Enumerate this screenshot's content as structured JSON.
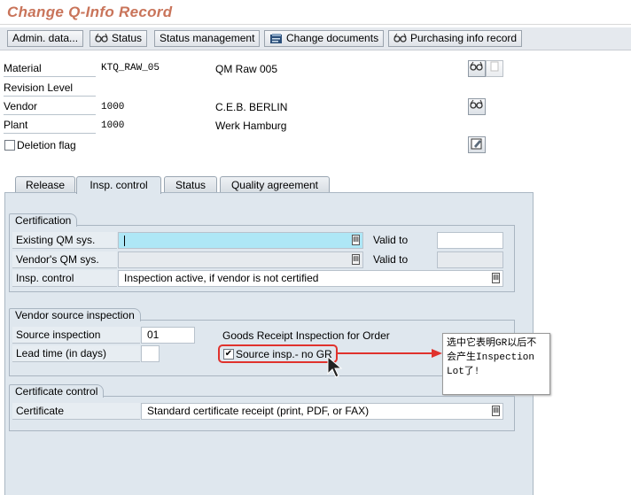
{
  "window": {
    "title": "Change Q-Info Record"
  },
  "toolbar": {
    "admin_data": "Admin. data...",
    "status": "Status",
    "status_management": "Status management",
    "change_documents": "Change documents",
    "purchasing_info_record": "Purchasing info record"
  },
  "header": {
    "material_label": "Material",
    "material_value": "KTQ_RAW_05",
    "material_desc": "QM Raw 005",
    "revision_label": "Revision Level",
    "vendor_label": "Vendor",
    "vendor_value": "1000",
    "vendor_name": "C.E.B. BERLIN",
    "plant_label": "Plant",
    "plant_value": "1000",
    "plant_name": "Werk Hamburg",
    "deletion_flag_label": "Deletion flag",
    "deletion_flag_checked": false
  },
  "tabs": [
    {
      "label": "Release",
      "active": false
    },
    {
      "label": "Insp. control",
      "active": true
    },
    {
      "label": "Status",
      "active": false
    },
    {
      "label": "Quality agreement",
      "active": false
    }
  ],
  "certification": {
    "title": "Certification",
    "existing_label": "Existing QM sys.",
    "existing_value": "",
    "valid_to_label": "Valid to",
    "valid_to_value": "",
    "vendor_qm_label": "Vendor's QM sys.",
    "vendor_qm_value": "",
    "valid_to2_label": "Valid to",
    "valid_to2_value": "",
    "insp_control_label": "Insp. control",
    "insp_control_value": "Inspection active, if vendor is not certified"
  },
  "vendor_source": {
    "title": "Vendor source inspection",
    "source_insp_label": "Source inspection",
    "source_insp_value": "01",
    "lead_time_label": "Lead time (in days)",
    "lead_time_value": "",
    "gr_title": "Goods Receipt Inspection for Order",
    "no_gr_label": "Source insp.- no GR",
    "no_gr_checked": true
  },
  "certificate_control": {
    "title": "Certificate control",
    "certificate_label": "Certificate",
    "certificate_value": "Standard certificate receipt (print, PDF, or FAX)"
  },
  "annotation": {
    "text": "选中它表明GR以后不会产生Inspection Lot了!",
    "color": "#e0322d"
  }
}
